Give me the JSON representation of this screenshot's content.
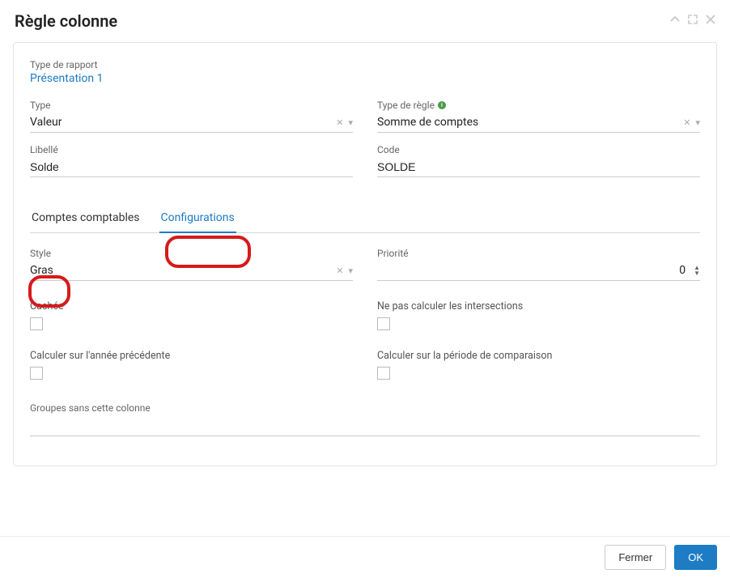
{
  "dialog": {
    "title": "Règle colonne"
  },
  "reportType": {
    "label": "Type de rapport",
    "value": "Présentation 1"
  },
  "type": {
    "label": "Type",
    "value": "Valeur"
  },
  "ruleType": {
    "label": "Type de règle",
    "value": "Somme de comptes"
  },
  "libelle": {
    "label": "Libellé",
    "value": "Solde"
  },
  "code": {
    "label": "Code",
    "value": "SOLDE"
  },
  "tabs": {
    "accounts": "Comptes comptables",
    "configs": "Configurations"
  },
  "style": {
    "label": "Style",
    "value": "Gras"
  },
  "priority": {
    "label": "Priorité",
    "value": "0"
  },
  "hidden": {
    "label": "Cachée"
  },
  "noIntersect": {
    "label": "Ne pas calculer les intersections"
  },
  "prevYear": {
    "label": "Calculer sur l'année précédente"
  },
  "compPeriod": {
    "label": "Calculer sur la période de comparaison"
  },
  "groupsWithout": {
    "label": "Groupes sans cette colonne"
  },
  "footer": {
    "close": "Fermer",
    "ok": "OK"
  }
}
